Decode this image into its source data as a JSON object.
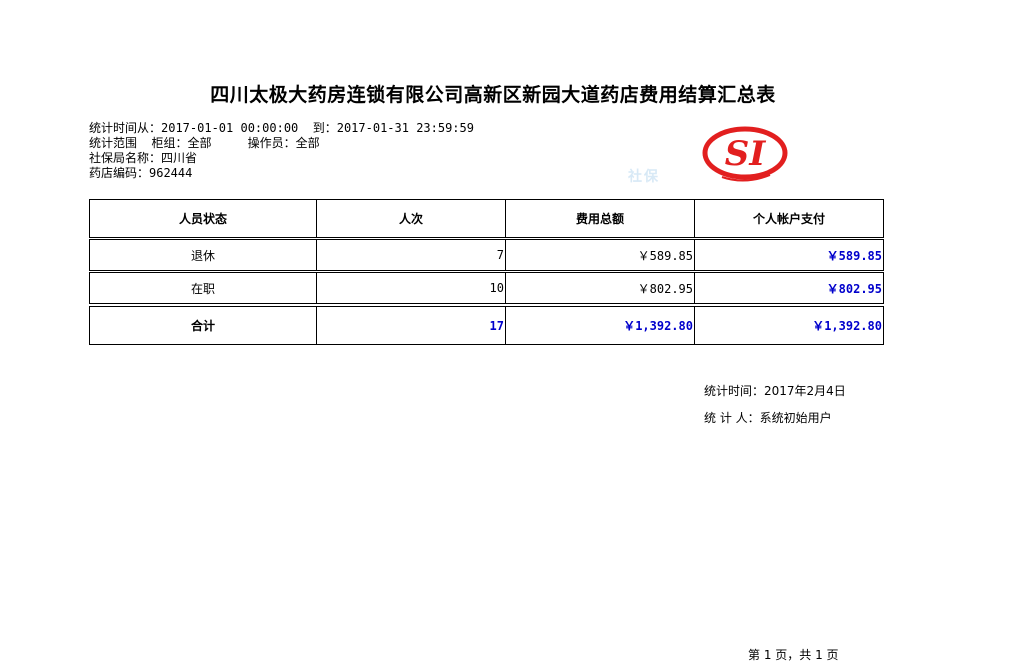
{
  "title": "四川太极大药房连锁有限公司高新区新园大道药店费用结算汇总表",
  "meta": {
    "period": "统计时间从：2017-01-01 00:00:00  到：2017-01-31 23:59:59",
    "scope": "统计范围  柜组：全部     操作员：全部",
    "bureau": "社保局名称：四川省",
    "store_code": "药店编码：962444"
  },
  "logo": {
    "text": "SI",
    "sub_text": "社保",
    "color": "#e21f1f"
  },
  "table": {
    "headers": [
      "人员状态",
      "人次",
      "费用总额",
      "个人帐户支付"
    ],
    "rows": [
      {
        "status": "退休",
        "count": "7",
        "total": "￥589.85",
        "personal": "￥589.85"
      },
      {
        "status": "在职",
        "count": "10",
        "total": "￥802.95",
        "personal": "￥802.95"
      }
    ],
    "total_row": {
      "label": "合计",
      "count": "17",
      "total": "￥1,392.80",
      "personal": "￥1,392.80"
    }
  },
  "footer": {
    "stat_time": "统计时间：2017年2月4日",
    "stat_person": "统 计 人：系统初始用户",
    "page": "第 1 页，共 1 页"
  },
  "colors": {
    "accent_blue": "#0000cc",
    "logo_red": "#e21f1f"
  }
}
